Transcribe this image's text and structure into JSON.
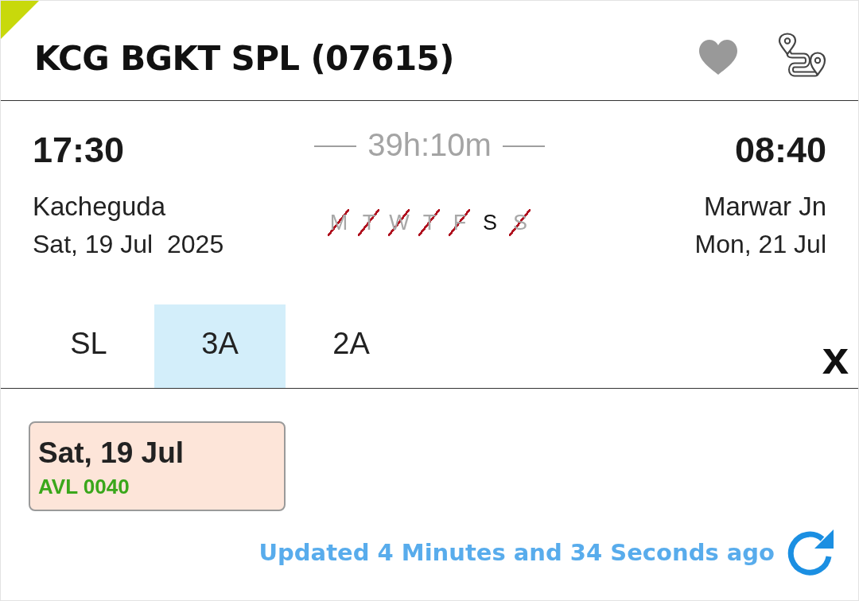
{
  "train": {
    "title": "KCG BGKT SPL (07615)"
  },
  "departure": {
    "time": "17:30",
    "station": "Kacheguda",
    "date": "Sat, 19 Jul  2025"
  },
  "duration": "39h:10m",
  "run_days": [
    {
      "label": "M",
      "runs": false
    },
    {
      "label": "T",
      "runs": false
    },
    {
      "label": "W",
      "runs": false
    },
    {
      "label": "T",
      "runs": false
    },
    {
      "label": "F",
      "runs": false
    },
    {
      "label": "S",
      "runs": true
    },
    {
      "label": "S",
      "runs": false
    }
  ],
  "arrival": {
    "time": "08:40",
    "station": "Marwar Jn",
    "date": "Mon, 21 Jul"
  },
  "classes": [
    {
      "label": "SL",
      "selected": false
    },
    {
      "label": "3A",
      "selected": true
    },
    {
      "label": "2A",
      "selected": false
    }
  ],
  "close_button": "x",
  "availability": [
    {
      "date": "Sat, 19 Jul",
      "status": "AVL 0040"
    }
  ],
  "updated": "Updated 4 Minutes and 34 Seconds ago"
}
